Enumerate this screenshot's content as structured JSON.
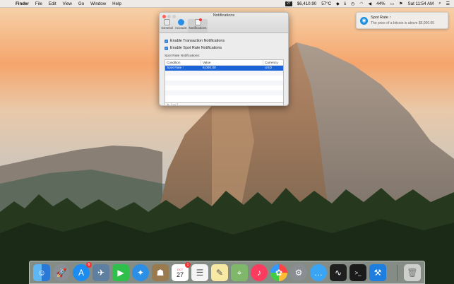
{
  "menubar": {
    "app_name": "Finder",
    "menus": [
      "File",
      "Edit",
      "View",
      "Go",
      "Window",
      "Help"
    ],
    "calendar_badge": "27",
    "price": "$6,410.90",
    "temperature": "57°C",
    "battery": "44%",
    "clock": "Sat 11:54 AM"
  },
  "notification": {
    "title": "Spot Rate ↑",
    "message": "The price of a bitcoin is above $6,000.00"
  },
  "window": {
    "title": "Notifications",
    "tabs": [
      "General",
      "Account",
      "Notifications"
    ],
    "checkbox_transaction": "Enable Transaction Notifications",
    "checkbox_spot_rate": "Enable Spot Rate Notifications",
    "section_label": "Spot Rate Notifications:",
    "columns": [
      "Condition",
      "Value",
      "Currency"
    ],
    "rows": [
      {
        "condition": "Spot Rate ↑",
        "value": "6,000.00",
        "currency": "USD"
      }
    ],
    "add_label": "+",
    "remove_label": "—"
  },
  "dock": {
    "app_store_badge": "6",
    "calendar_month": "OCT",
    "calendar_day": "27",
    "calendar_badge": "1"
  }
}
